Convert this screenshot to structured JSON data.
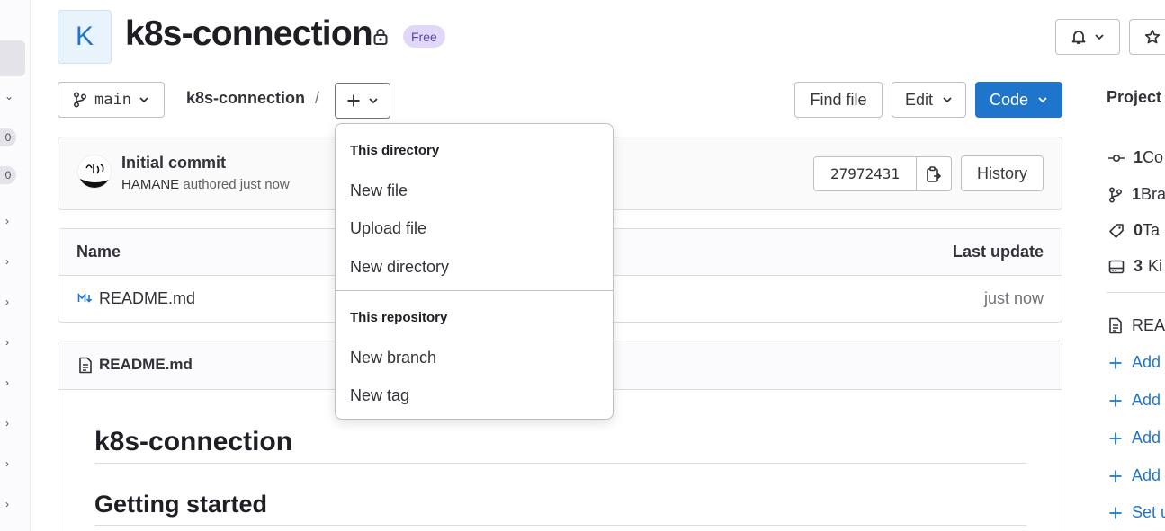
{
  "project": {
    "avatar_letter": "K",
    "name": "k8s-connection",
    "badge": "Free"
  },
  "toolbar": {
    "branch": "main",
    "breadcrumb_project": "k8s-connection",
    "breadcrumb_sep": "/",
    "find_file": "Find file",
    "edit": "Edit",
    "code": "Code"
  },
  "commit": {
    "title": "Initial commit",
    "author": "HAMANE",
    "meta": " authored just now",
    "sha": "27972431",
    "history": "History"
  },
  "file_table": {
    "col_name": "Name",
    "col_update": "Last update",
    "rows": [
      {
        "name": "README.md",
        "updated": "just now"
      }
    ]
  },
  "readme": {
    "file": "README.md",
    "h1": "k8s-connection",
    "h2": "Getting started"
  },
  "sidebar_left": {
    "badges": [
      "0",
      "0"
    ]
  },
  "right_sidebar": {
    "heading": "Project",
    "stats": [
      {
        "count": "1",
        "label": "Co"
      },
      {
        "count": "1",
        "label": "Bra"
      },
      {
        "count": "0",
        "label": "Ta"
      },
      {
        "count": "3",
        "label": "Ki"
      }
    ],
    "links": [
      "REA",
      "Add",
      "Add",
      "Add",
      "Add",
      "Set u"
    ]
  },
  "dropdown": {
    "section1": "This directory",
    "items1": [
      "New file",
      "Upload file",
      "New directory"
    ],
    "section2": "This repository",
    "items2": [
      "New branch",
      "New tag"
    ]
  },
  "colors": {
    "primary": "#1f75cb",
    "badge_bg": "#e1d8f9",
    "badge_text": "#5c47a6"
  }
}
